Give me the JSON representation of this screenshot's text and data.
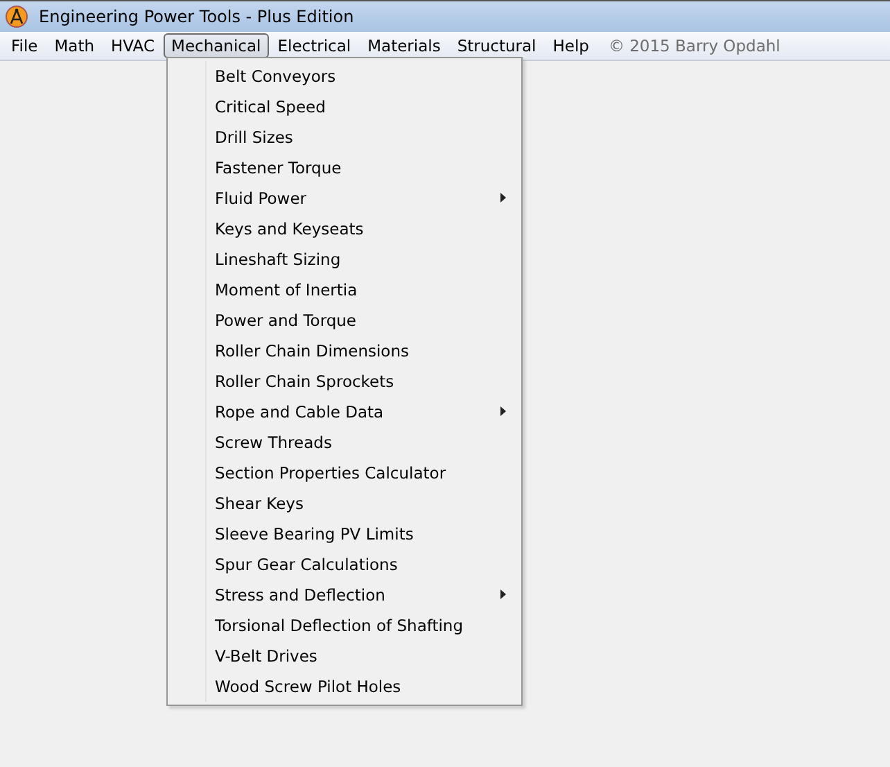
{
  "window": {
    "title": "Engineering Power Tools - Plus Edition"
  },
  "menubar": {
    "items": [
      {
        "label": "File",
        "selected": false
      },
      {
        "label": "Math",
        "selected": false
      },
      {
        "label": "HVAC",
        "selected": false
      },
      {
        "label": "Mechanical",
        "selected": true
      },
      {
        "label": "Electrical",
        "selected": false
      },
      {
        "label": "Materials",
        "selected": false
      },
      {
        "label": "Structural",
        "selected": false
      },
      {
        "label": "Help",
        "selected": false
      }
    ],
    "copyright": "© 2015 Barry Opdahl"
  },
  "menu": {
    "items": [
      {
        "label": "Belt Conveyors",
        "submenu": false
      },
      {
        "label": "Critical Speed",
        "submenu": false
      },
      {
        "label": "Drill Sizes",
        "submenu": false
      },
      {
        "label": "Fastener Torque",
        "submenu": false
      },
      {
        "label": "Fluid Power",
        "submenu": true
      },
      {
        "label": "Keys and Keyseats",
        "submenu": false
      },
      {
        "label": "Lineshaft Sizing",
        "submenu": false
      },
      {
        "label": "Moment of Inertia",
        "submenu": false
      },
      {
        "label": "Power and Torque",
        "submenu": false
      },
      {
        "label": "Roller Chain Dimensions",
        "submenu": false
      },
      {
        "label": "Roller Chain Sprockets",
        "submenu": false
      },
      {
        "label": "Rope and Cable Data",
        "submenu": true
      },
      {
        "label": "Screw Threads",
        "submenu": false
      },
      {
        "label": "Section Properties Calculator",
        "submenu": false
      },
      {
        "label": "Shear Keys",
        "submenu": false
      },
      {
        "label": "Sleeve Bearing PV Limits",
        "submenu": false
      },
      {
        "label": "Spur Gear Calculations",
        "submenu": false
      },
      {
        "label": "Stress and Deflection",
        "submenu": true
      },
      {
        "label": "Torsional Deflection of Shafting",
        "submenu": false
      },
      {
        "label": "V-Belt Drives",
        "submenu": false
      },
      {
        "label": "Wood Screw Pilot Holes",
        "submenu": false
      }
    ]
  }
}
